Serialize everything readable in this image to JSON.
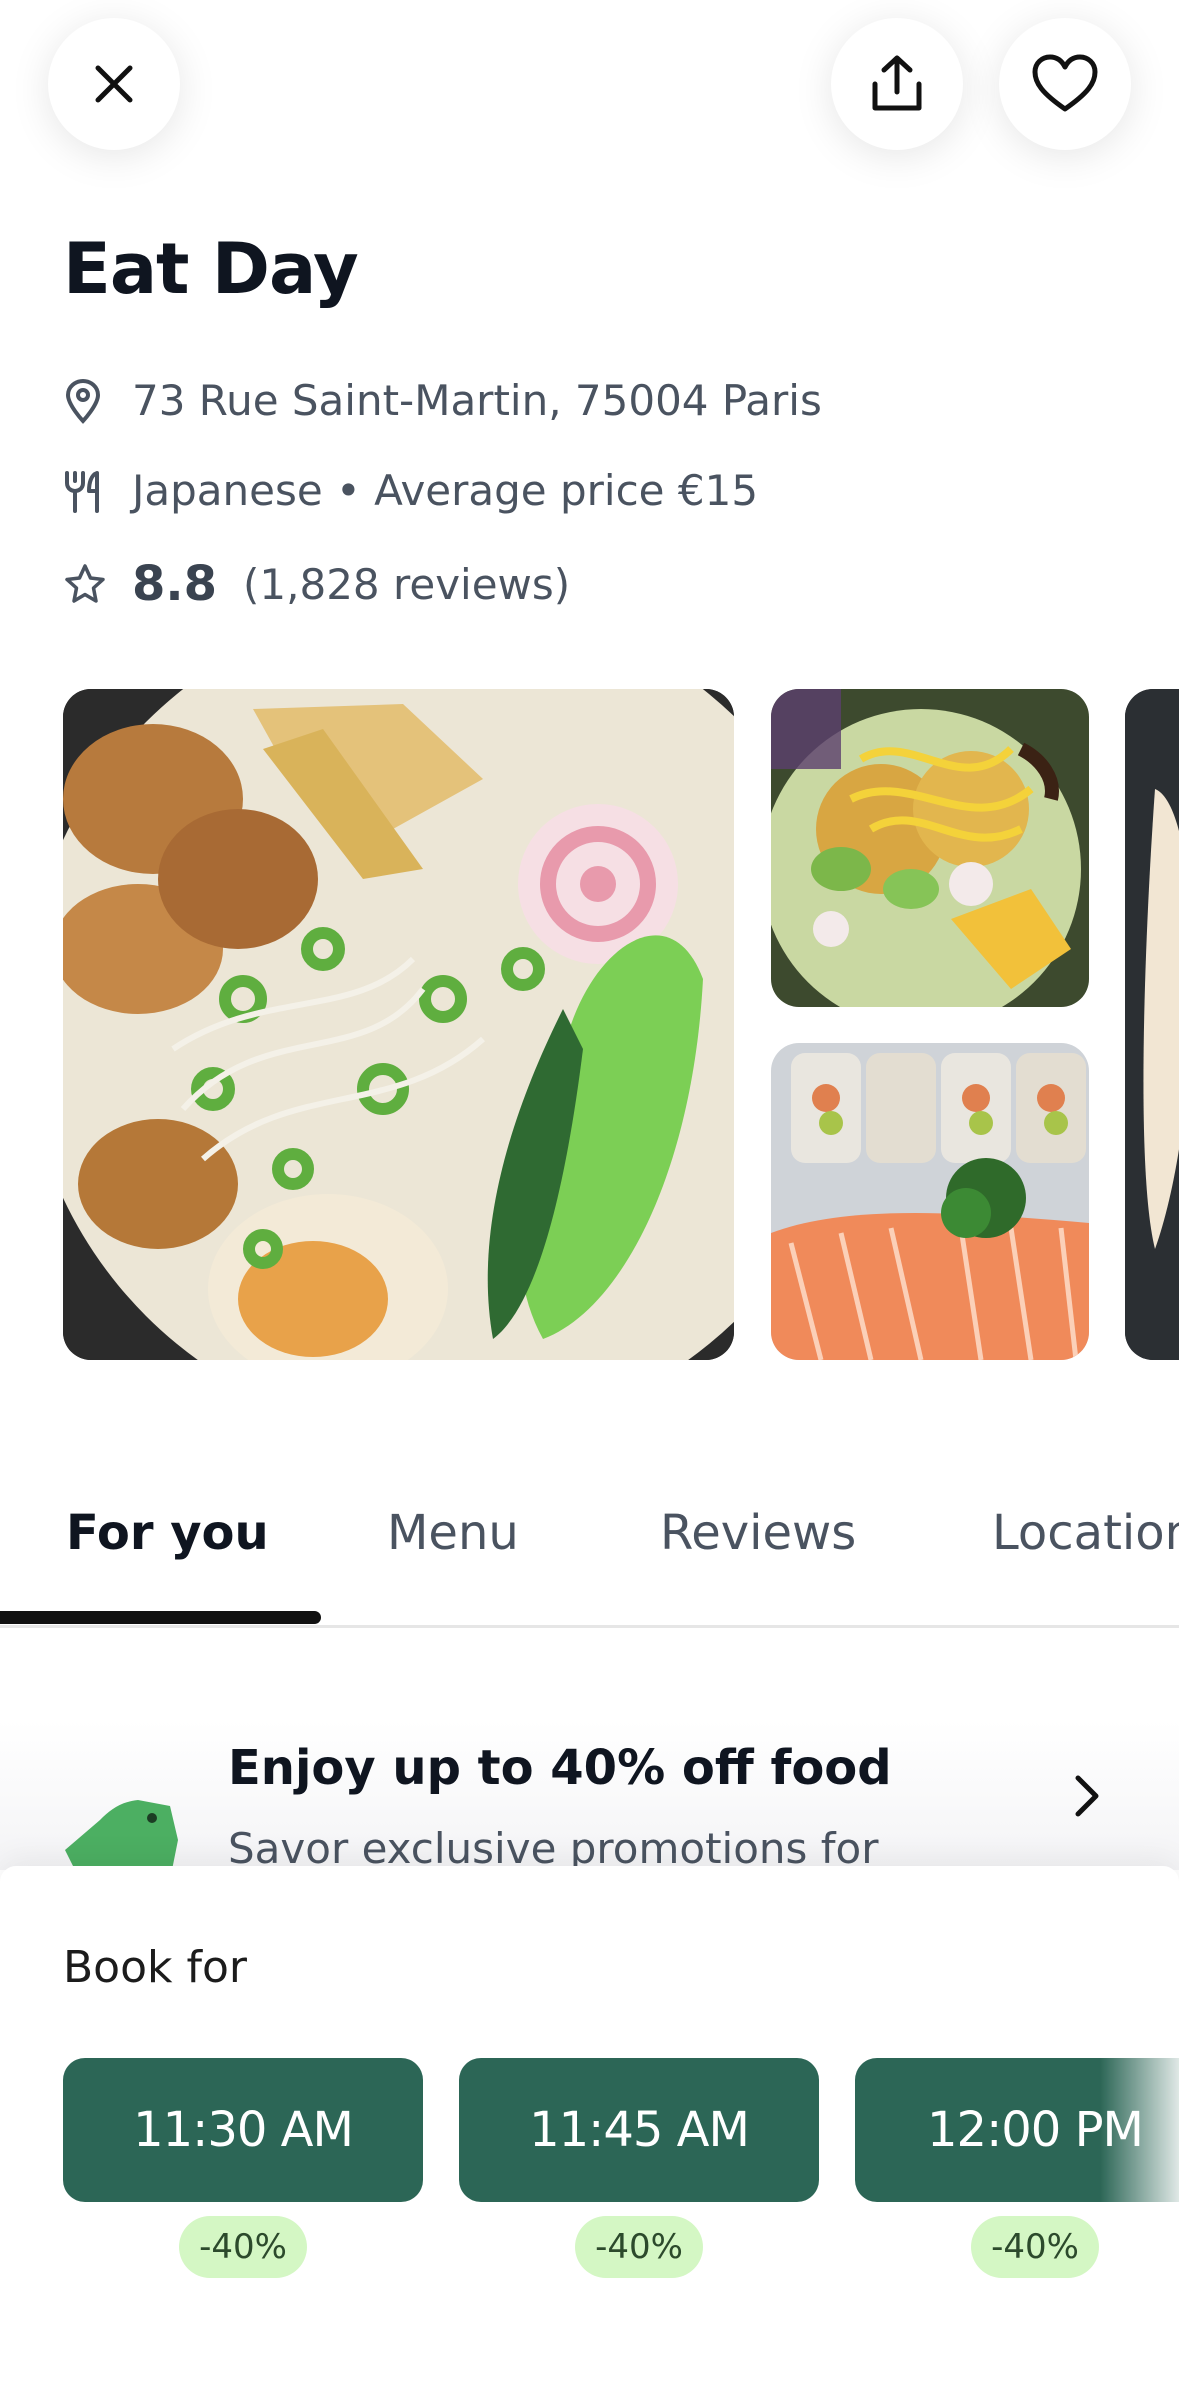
{
  "header": {
    "close_icon": "close-icon",
    "share_icon": "share-icon",
    "favorite_icon": "heart-icon"
  },
  "restaurant": {
    "name": "Eat Day",
    "address": "73 Rue Saint-Martin, 75004 Paris",
    "cuisine_price": "Japanese • Average price €15",
    "rating": "8.8",
    "reviews": "(1,828 reviews)"
  },
  "tabs": [
    {
      "label": "For you",
      "active": true
    },
    {
      "label": "Menu",
      "active": false
    },
    {
      "label": "Reviews",
      "active": false
    },
    {
      "label": "Location",
      "active": false
    }
  ],
  "promo": {
    "title": "Enjoy up to 40% off food",
    "subtitle": "Savor exclusive promotions for"
  },
  "booking": {
    "label": "Book for",
    "slots": [
      {
        "time": "11:30 AM",
        "discount": "-40%"
      },
      {
        "time": "11:45 AM",
        "discount": "-40%"
      },
      {
        "time": "12:00 PM",
        "discount": "-40%"
      }
    ]
  },
  "colors": {
    "slot_bg": "#2c6656",
    "badge_bg": "#d4f7c4",
    "promo_icon": "#4caf62"
  }
}
